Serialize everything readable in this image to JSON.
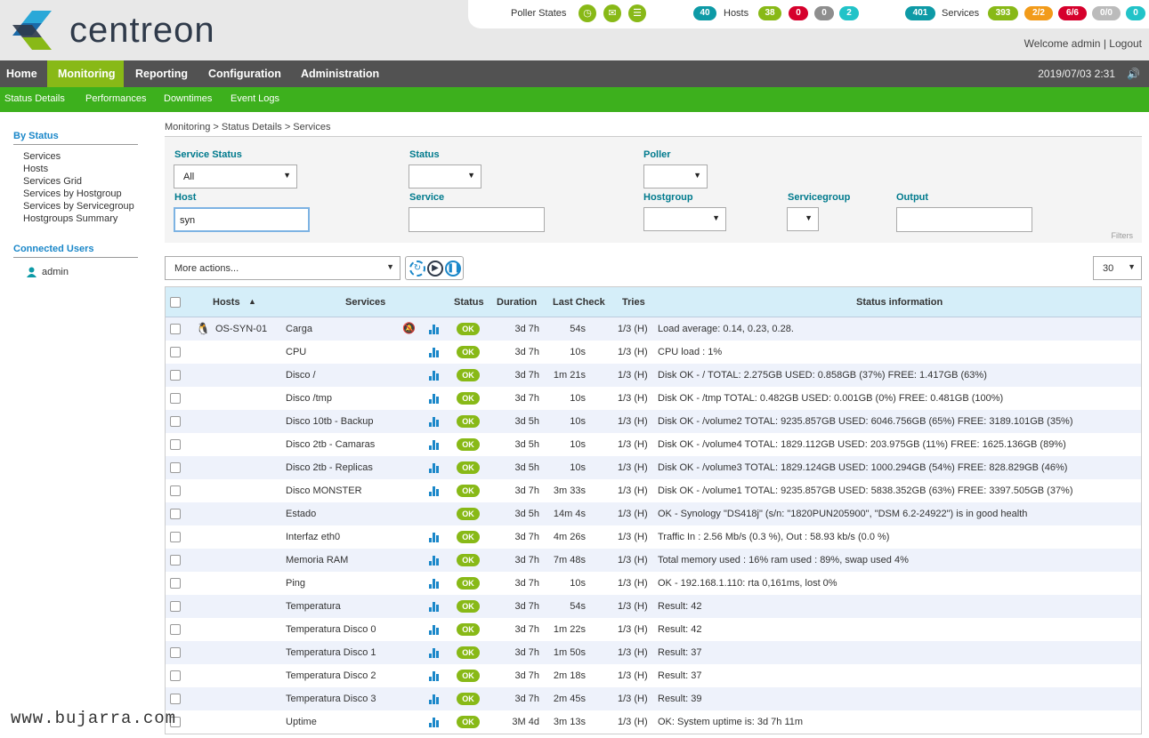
{
  "header": {
    "logo_text": "centreon",
    "poller_states_label": "Poller States",
    "poller_icons": [
      "clock-icon",
      "inbox-icon",
      "database-icon"
    ],
    "hosts": {
      "label": "Hosts",
      "total": "40",
      "up": "38",
      "down": "0",
      "unreachable": "0",
      "pending": "2"
    },
    "services": {
      "label": "Services",
      "total": "401",
      "ok": "393",
      "warning": "2/2",
      "critical": "6/6",
      "unknown": "0/0",
      "pending": "0"
    },
    "welcome": "Welcome admin",
    "logout": "Logout",
    "separator": "|",
    "datetime": "2019/07/03 2:31"
  },
  "mainnav": [
    "Home",
    "Monitoring",
    "Reporting",
    "Configuration",
    "Administration"
  ],
  "subnav": [
    "Status  Details",
    "Performances",
    "Downtimes",
    "Event  Logs"
  ],
  "sidebar": {
    "by_status_title": "By Status",
    "items": [
      "Services",
      "Hosts",
      "Services Grid",
      "Services by Hostgroup",
      "Services by Servicegroup",
      "Hostgroups Summary"
    ],
    "connected_title": "Connected Users",
    "user": "admin"
  },
  "breadcrumb": "Monitoring  >  Status Details  >  Services",
  "filters": {
    "service_status_label": "Service Status",
    "service_status_value": "All",
    "status_label": "Status",
    "status_value": "",
    "poller_label": "Poller",
    "poller_value": "",
    "host_label": "Host",
    "host_value": "syn",
    "service_label": "Service",
    "service_value": "",
    "hostgroup_label": "Hostgroup",
    "hostgroup_value": "",
    "servicegroup_label": "Servicegroup",
    "servicegroup_value": "",
    "output_label": "Output",
    "output_value": "",
    "filters_link": "Filters"
  },
  "actions": {
    "more_actions": "More actions...",
    "limit": "30"
  },
  "table": {
    "headers": {
      "hosts": "Hosts",
      "services": "Services",
      "status": "Status",
      "duration": "Duration",
      "last_check": "Last Check",
      "tries": "Tries",
      "status_info": "Status information"
    },
    "host": "OS-SYN-01",
    "rows": [
      {
        "service": "Carga",
        "status": "OK",
        "duration": "3d 7h",
        "last_check": "54s",
        "tries": "1/3 (H)",
        "info": "Load average: 0.14, 0.23, 0.28."
      },
      {
        "service": "CPU",
        "status": "OK",
        "duration": "3d 7h",
        "last_check": "10s",
        "tries": "1/3 (H)",
        "info": "CPU load : 1%"
      },
      {
        "service": "Disco /",
        "status": "OK",
        "duration": "3d 7h",
        "last_check": "1m 21s",
        "tries": "1/3 (H)",
        "info": "Disk OK - / TOTAL: 2.275GB USED: 0.858GB (37%) FREE: 1.417GB (63%)"
      },
      {
        "service": "Disco /tmp",
        "status": "OK",
        "duration": "3d 7h",
        "last_check": "10s",
        "tries": "1/3 (H)",
        "info": "Disk OK - /tmp TOTAL: 0.482GB USED: 0.001GB (0%) FREE: 0.481GB (100%)"
      },
      {
        "service": "Disco 10tb - Backup",
        "status": "OK",
        "duration": "3d 5h",
        "last_check": "10s",
        "tries": "1/3 (H)",
        "info": "Disk OK - /volume2 TOTAL: 9235.857GB USED: 6046.756GB (65%) FREE: 3189.101GB (35%)"
      },
      {
        "service": "Disco 2tb - Camaras",
        "status": "OK",
        "duration": "3d 5h",
        "last_check": "10s",
        "tries": "1/3 (H)",
        "info": "Disk OK - /volume4 TOTAL: 1829.112GB USED: 203.975GB (11%) FREE: 1625.136GB (89%)"
      },
      {
        "service": "Disco 2tb - Replicas",
        "status": "OK",
        "duration": "3d 5h",
        "last_check": "10s",
        "tries": "1/3 (H)",
        "info": "Disk OK - /volume3 TOTAL: 1829.124GB USED: 1000.294GB (54%) FREE: 828.829GB (46%)"
      },
      {
        "service": "Disco MONSTER",
        "status": "OK",
        "duration": "3d 7h",
        "last_check": "3m 33s",
        "tries": "1/3 (H)",
        "info": "Disk OK - /volume1 TOTAL: 9235.857GB USED: 5838.352GB (63%) FREE: 3397.505GB (37%)"
      },
      {
        "service": "Estado",
        "status": "OK",
        "duration": "3d 5h",
        "last_check": "14m 4s",
        "tries": "1/3 (H)",
        "info": "OK - Synology \"DS418j\" (s/n: \"1820PUN205900\", \"DSM 6.2-24922\") is in good health"
      },
      {
        "service": "Interfaz eth0",
        "status": "OK",
        "duration": "3d 7h",
        "last_check": "4m 26s",
        "tries": "1/3 (H)",
        "info": "Traffic In : 2.56 Mb/s (0.3 %), Out : 58.93 kb/s (0.0 %)"
      },
      {
        "service": "Memoria RAM",
        "status": "OK",
        "duration": "3d 7h",
        "last_check": "7m 48s",
        "tries": "1/3 (H)",
        "info": "Total memory used : 16% ram used : 89%, swap used 4%"
      },
      {
        "service": "Ping",
        "status": "OK",
        "duration": "3d 7h",
        "last_check": "10s",
        "tries": "1/3 (H)",
        "info": "OK - 192.168.1.110: rta 0,161ms, lost 0%"
      },
      {
        "service": "Temperatura",
        "status": "OK",
        "duration": "3d 7h",
        "last_check": "54s",
        "tries": "1/3 (H)",
        "info": "Result: 42"
      },
      {
        "service": "Temperatura Disco 0",
        "status": "OK",
        "duration": "3d 7h",
        "last_check": "1m 22s",
        "tries": "1/3 (H)",
        "info": "Result: 42"
      },
      {
        "service": "Temperatura Disco 1",
        "status": "OK",
        "duration": "3d 7h",
        "last_check": "1m 50s",
        "tries": "1/3 (H)",
        "info": "Result: 37"
      },
      {
        "service": "Temperatura Disco 2",
        "status": "OK",
        "duration": "3d 7h",
        "last_check": "2m 18s",
        "tries": "1/3 (H)",
        "info": "Result: 37"
      },
      {
        "service": "Temperatura Disco 3",
        "status": "OK",
        "duration": "3d 7h",
        "last_check": "2m 45s",
        "tries": "1/3 (H)",
        "info": "Result: 39"
      },
      {
        "service": "Uptime",
        "status": "OK",
        "duration": "3M 4d",
        "last_check": "3m 13s",
        "tries": "1/3 (H)",
        "info": "OK: System uptime is: 3d 7h 11m"
      }
    ]
  },
  "watermark": "www.bujarra.com",
  "colors": {
    "green": "#88b917",
    "orange": "#f29b1a",
    "red": "#d6002c",
    "grey": "#8e8e8e",
    "teal": "#0d9aa6",
    "cyan": "#22c3c8",
    "nav_dark": "#525252",
    "subnav_green": "#3db01d",
    "accent_blue": "#1a87c9"
  }
}
